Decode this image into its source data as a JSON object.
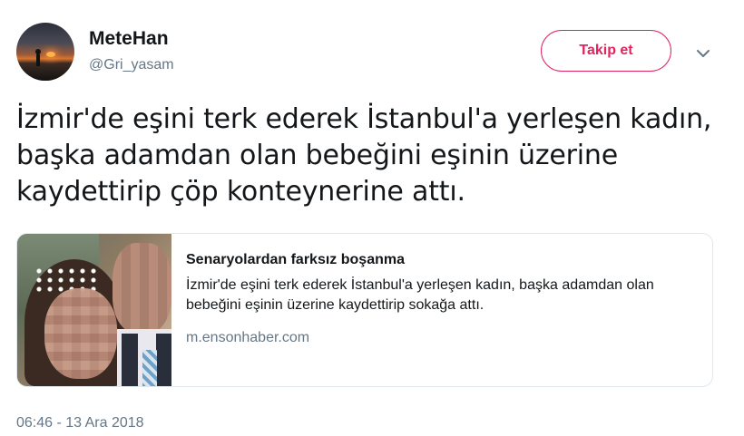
{
  "user": {
    "display_name": "MeteHan",
    "handle": "@Gri_yasam"
  },
  "actions": {
    "follow_label": "Takip et",
    "menu_icon": "chevron-down-icon"
  },
  "tweet": {
    "text": "İzmir'de eşini terk ederek İstanbul'a yerleşen kadın, başka adamdan olan bebeğini eşinin üzerine kaydettirip çöp konteynerine attı.",
    "timestamp": "06:46 - 13 Ara 2018"
  },
  "card": {
    "title": "Senaryolardan farksız boşanma",
    "description": "İzmir'de eşini terk ederek İstanbul'a yerleşen kadın, başka adamdan olan bebeğini eşinin üzerine kaydettirip sokağa attı.",
    "domain": "m.ensonhaber.com"
  },
  "colors": {
    "follow_accent": "#e0245e",
    "secondary_text": "#657786",
    "primary_text": "#14171a",
    "border": "#e1e8ed"
  }
}
